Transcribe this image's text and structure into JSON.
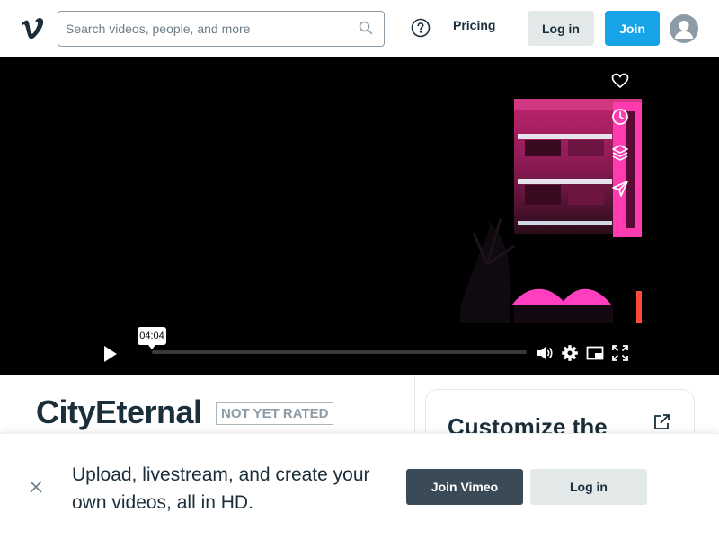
{
  "header": {
    "logo_text": "v",
    "search": {
      "placeholder": "Search videos, people, and more",
      "value": ""
    },
    "pricing_label": "Pricing",
    "login_label": "Log in",
    "join_label": "Join"
  },
  "player": {
    "time_tooltip": "04:04",
    "side_actions": [
      "heart-icon",
      "clock-icon",
      "layers-icon",
      "send-icon"
    ],
    "controls": [
      "play-icon",
      "volume-icon",
      "settings-icon",
      "pip-icon",
      "fullscreen-icon"
    ]
  },
  "video": {
    "title": "CityEternal",
    "rating": "NOT YET RATED"
  },
  "customize_card": {
    "title": "Customize the"
  },
  "banner": {
    "text": "Upload, livestream, and create your own videos, all in HD.",
    "join_label": "Join Vimeo",
    "login_label": "Log in"
  },
  "colors": {
    "accent": "#17a3e8",
    "dark_button": "#3a4b57",
    "light_button": "#e3e8e9",
    "text": "#1a2e3b"
  }
}
